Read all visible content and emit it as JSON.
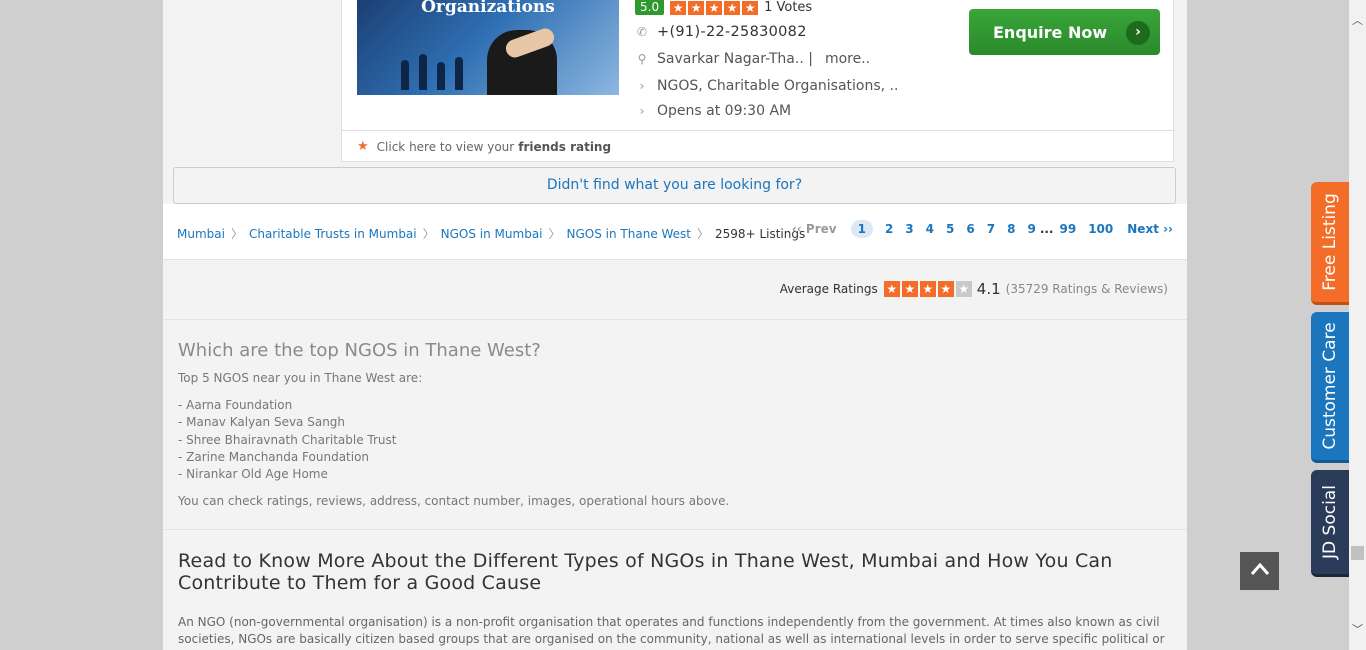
{
  "listing": {
    "image_text": "Organizations",
    "rating": "5.0",
    "votes": "1 Votes",
    "phone": "+(91)-22-25830082",
    "address": "Savarkar Nagar-Tha.. |",
    "address_more": "more..",
    "categories": "NGOS, Charitable Organisations,  ..",
    "hours": "Opens at 09:30 AM",
    "enquire_label": "Enquire Now",
    "friends_prefix": "Click here to view your",
    "friends_bold": "friends rating"
  },
  "not_found": "Didn't find what you are looking for?",
  "breadcrumb": {
    "items": [
      "Mumbai",
      "Charitable Trusts in Mumbai",
      "NGOS in Mumbai",
      "NGOS in Thane West"
    ],
    "count": "2598+ Listings"
  },
  "pager": {
    "prev": "‹‹ Prev",
    "pages": [
      "1",
      "2",
      "3",
      "4",
      "5",
      "6",
      "7",
      "8",
      "9"
    ],
    "dots": "...",
    "extra": [
      "99",
      "100"
    ],
    "next": "Next ››"
  },
  "average": {
    "label": "Average Ratings",
    "score": "4.1",
    "reviews": "(35729 Ratings & Reviews)"
  },
  "faq": {
    "title": "Which are the top NGOS in Thane West?",
    "intro": "Top 5 NGOS near you in Thane West are:",
    "items": [
      "- Aarna Foundation",
      "- Manav Kalyan Seva Sangh",
      "- Shree Bhairavnath Charitable Trust",
      "- Zarine Manchanda Foundation",
      "- Nirankar Old Age Home"
    ],
    "outro": "You can check ratings, reviews, address, contact number, images, operational hours above."
  },
  "article": {
    "title": "Read to Know More About the Different Types of NGOs in Thane West, Mumbai and How You Can Contribute to Them for a Good Cause",
    "body": "An NGO (non-governmental organisation) is a non-profit organisation that operates and functions independently from the government. At times also known as civil societies, NGOs are basically citizen based groups that are organised on the community, national as well as international levels in order to serve specific political or social issues"
  },
  "side_tabs": {
    "free_listing": "Free Listing",
    "customer_care": "Customer Care",
    "jd_social": "JD Social"
  },
  "colors": {
    "accent_blue": "#1b76bd",
    "star_orange": "#f36d28",
    "enquire_green": "#2a8a2a"
  }
}
